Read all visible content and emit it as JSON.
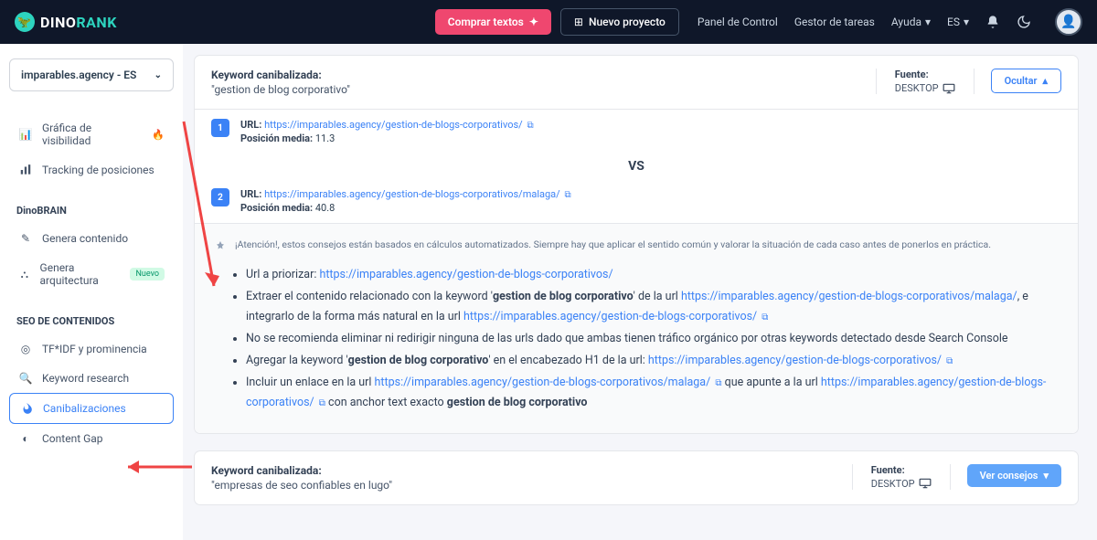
{
  "topbar": {
    "brand_a": "DINO",
    "brand_b": "RANK",
    "buy_texts": "Comprar textos",
    "new_project": "Nuevo proyecto",
    "panel": "Panel de Control",
    "tasks": "Gestor de tareas",
    "help": "Ayuda",
    "lang": "ES"
  },
  "sidebar": {
    "site": "imparables.agency - ES",
    "item_visibility": "Gráfica de visibilidad",
    "item_tracking": "Tracking de posiciones",
    "heading_brain": "DinoBRAIN",
    "item_gen_content": "Genera contenido",
    "item_gen_arch": "Genera arquitectura",
    "badge_new": "Nuevo",
    "heading_seo": "SEO DE CONTENIDOS",
    "item_tfidf": "TF*IDF y prominencia",
    "item_kwresearch": "Keyword research",
    "item_canibal": "Canibalizaciones",
    "item_gap": "Content Gap"
  },
  "card1": {
    "kw_label": "Keyword canibalizada:",
    "kw_value": "\"gestion de blog corporativo\"",
    "fuente_label": "Fuente:",
    "fuente_value": "DESKTOP",
    "btn_hide": "Ocultar",
    "url_label": "URL:",
    "url1": "https://imparables.agency/gestion-de-blogs-corporativos/",
    "pos_label": "Posición media:",
    "pos1": "11.3",
    "vs": "VS",
    "url2": "https://imparables.agency/gestion-de-blogs-corporativos/malaga/",
    "pos2": "40.8",
    "advice_note": "¡Atención!, estos consejos están basados en cálculos automatizados. Siempre hay que aplicar el sentido común y valorar la situación de cada caso antes de ponerlos en práctica.",
    "adv": {
      "priorizar_pre": "Url a priorizar: ",
      "priorizar_url": "https://imparables.agency/gestion-de-blogs-corporativos/",
      "extraer_a": "Extraer el contenido relacionado con la keyword '",
      "extraer_kw": "gestion de blog corporativo",
      "extraer_b": "' de la url ",
      "extraer_url1": "https://imparables.agency/gestion-de-blogs-corporativos/malaga/",
      "extraer_c": ", e integrarlo de la forma más natural en la url ",
      "extraer_url2": "https://imparables.agency/gestion-de-blogs-corporativos/",
      "no_elim": "No se recomienda eliminar ni redirigir ninguna de las urls dado que ambas tienen tráfico orgánico por otras keywords detectado desde Search Console",
      "agregar_a": "Agregar la keyword '",
      "agregar_kw": "gestion de blog corporativo",
      "agregar_b": "' en el encabezado H1 de la url: ",
      "agregar_url": "https://imparables.agency/gestion-de-blogs-corporativos/",
      "incluir_a": "Incluir un enlace en la url ",
      "incluir_url1": "https://imparables.agency/gestion-de-blogs-corporativos/malaga/",
      "incluir_b": " que apunte a la url ",
      "incluir_url2": "https://imparables.agency/gestion-de-blogs-corporativos/",
      "incluir_c": " con anchor text exacto ",
      "incluir_anchor": "gestion de blog corporativo"
    }
  },
  "card2": {
    "kw_label": "Keyword canibalizada:",
    "kw_value": "\"empresas de seo confiables en lugo\"",
    "fuente_label": "Fuente:",
    "fuente_value": "DESKTOP",
    "btn": "Ver consejos"
  }
}
